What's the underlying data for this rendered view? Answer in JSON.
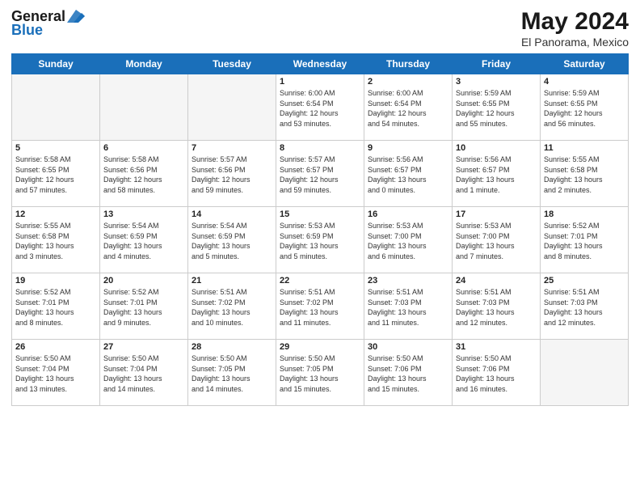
{
  "header": {
    "logo_line1": "General",
    "logo_line2": "Blue",
    "month": "May 2024",
    "location": "El Panorama, Mexico"
  },
  "weekdays": [
    "Sunday",
    "Monday",
    "Tuesday",
    "Wednesday",
    "Thursday",
    "Friday",
    "Saturday"
  ],
  "weeks": [
    [
      {
        "day": "",
        "info": ""
      },
      {
        "day": "",
        "info": ""
      },
      {
        "day": "",
        "info": ""
      },
      {
        "day": "1",
        "info": "Sunrise: 6:00 AM\nSunset: 6:54 PM\nDaylight: 12 hours\nand 53 minutes."
      },
      {
        "day": "2",
        "info": "Sunrise: 6:00 AM\nSunset: 6:54 PM\nDaylight: 12 hours\nand 54 minutes."
      },
      {
        "day": "3",
        "info": "Sunrise: 5:59 AM\nSunset: 6:55 PM\nDaylight: 12 hours\nand 55 minutes."
      },
      {
        "day": "4",
        "info": "Sunrise: 5:59 AM\nSunset: 6:55 PM\nDaylight: 12 hours\nand 56 minutes."
      }
    ],
    [
      {
        "day": "5",
        "info": "Sunrise: 5:58 AM\nSunset: 6:55 PM\nDaylight: 12 hours\nand 57 minutes."
      },
      {
        "day": "6",
        "info": "Sunrise: 5:58 AM\nSunset: 6:56 PM\nDaylight: 12 hours\nand 58 minutes."
      },
      {
        "day": "7",
        "info": "Sunrise: 5:57 AM\nSunset: 6:56 PM\nDaylight: 12 hours\nand 59 minutes."
      },
      {
        "day": "8",
        "info": "Sunrise: 5:57 AM\nSunset: 6:57 PM\nDaylight: 12 hours\nand 59 minutes."
      },
      {
        "day": "9",
        "info": "Sunrise: 5:56 AM\nSunset: 6:57 PM\nDaylight: 13 hours\nand 0 minutes."
      },
      {
        "day": "10",
        "info": "Sunrise: 5:56 AM\nSunset: 6:57 PM\nDaylight: 13 hours\nand 1 minute."
      },
      {
        "day": "11",
        "info": "Sunrise: 5:55 AM\nSunset: 6:58 PM\nDaylight: 13 hours\nand 2 minutes."
      }
    ],
    [
      {
        "day": "12",
        "info": "Sunrise: 5:55 AM\nSunset: 6:58 PM\nDaylight: 13 hours\nand 3 minutes."
      },
      {
        "day": "13",
        "info": "Sunrise: 5:54 AM\nSunset: 6:59 PM\nDaylight: 13 hours\nand 4 minutes."
      },
      {
        "day": "14",
        "info": "Sunrise: 5:54 AM\nSunset: 6:59 PM\nDaylight: 13 hours\nand 5 minutes."
      },
      {
        "day": "15",
        "info": "Sunrise: 5:53 AM\nSunset: 6:59 PM\nDaylight: 13 hours\nand 5 minutes."
      },
      {
        "day": "16",
        "info": "Sunrise: 5:53 AM\nSunset: 7:00 PM\nDaylight: 13 hours\nand 6 minutes."
      },
      {
        "day": "17",
        "info": "Sunrise: 5:53 AM\nSunset: 7:00 PM\nDaylight: 13 hours\nand 7 minutes."
      },
      {
        "day": "18",
        "info": "Sunrise: 5:52 AM\nSunset: 7:01 PM\nDaylight: 13 hours\nand 8 minutes."
      }
    ],
    [
      {
        "day": "19",
        "info": "Sunrise: 5:52 AM\nSunset: 7:01 PM\nDaylight: 13 hours\nand 8 minutes."
      },
      {
        "day": "20",
        "info": "Sunrise: 5:52 AM\nSunset: 7:01 PM\nDaylight: 13 hours\nand 9 minutes."
      },
      {
        "day": "21",
        "info": "Sunrise: 5:51 AM\nSunset: 7:02 PM\nDaylight: 13 hours\nand 10 minutes."
      },
      {
        "day": "22",
        "info": "Sunrise: 5:51 AM\nSunset: 7:02 PM\nDaylight: 13 hours\nand 11 minutes."
      },
      {
        "day": "23",
        "info": "Sunrise: 5:51 AM\nSunset: 7:03 PM\nDaylight: 13 hours\nand 11 minutes."
      },
      {
        "day": "24",
        "info": "Sunrise: 5:51 AM\nSunset: 7:03 PM\nDaylight: 13 hours\nand 12 minutes."
      },
      {
        "day": "25",
        "info": "Sunrise: 5:51 AM\nSunset: 7:03 PM\nDaylight: 13 hours\nand 12 minutes."
      }
    ],
    [
      {
        "day": "26",
        "info": "Sunrise: 5:50 AM\nSunset: 7:04 PM\nDaylight: 13 hours\nand 13 minutes."
      },
      {
        "day": "27",
        "info": "Sunrise: 5:50 AM\nSunset: 7:04 PM\nDaylight: 13 hours\nand 14 minutes."
      },
      {
        "day": "28",
        "info": "Sunrise: 5:50 AM\nSunset: 7:05 PM\nDaylight: 13 hours\nand 14 minutes."
      },
      {
        "day": "29",
        "info": "Sunrise: 5:50 AM\nSunset: 7:05 PM\nDaylight: 13 hours\nand 15 minutes."
      },
      {
        "day": "30",
        "info": "Sunrise: 5:50 AM\nSunset: 7:06 PM\nDaylight: 13 hours\nand 15 minutes."
      },
      {
        "day": "31",
        "info": "Sunrise: 5:50 AM\nSunset: 7:06 PM\nDaylight: 13 hours\nand 16 minutes."
      },
      {
        "day": "",
        "info": ""
      }
    ]
  ]
}
